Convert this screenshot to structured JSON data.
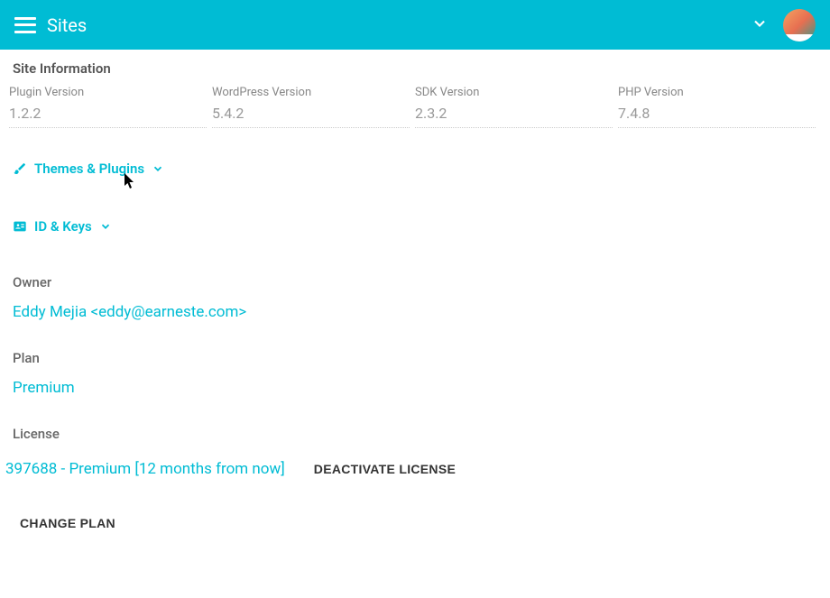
{
  "header": {
    "title": "Sites"
  },
  "siteInfo": {
    "heading": "Site Information",
    "fields": {
      "pluginVersion": {
        "label": "Plugin Version",
        "value": "1.2.2"
      },
      "wpVersion": {
        "label": "WordPress Version",
        "value": "5.4.2"
      },
      "sdkVersion": {
        "label": "SDK Version",
        "value": "2.3.2"
      },
      "phpVersion": {
        "label": "PHP Version",
        "value": "7.4.8"
      }
    }
  },
  "collapsibles": {
    "themesPlugins": "Themes & Plugins",
    "idKeys": "ID & Keys"
  },
  "owner": {
    "label": "Owner",
    "value": "Eddy Mejia <eddy@earneste.com>"
  },
  "plan": {
    "label": "Plan",
    "value": "Premium"
  },
  "license": {
    "label": "License",
    "value": "397688 - Premium [12 months from now]",
    "deactivate": "Deactivate License"
  },
  "actions": {
    "changePlan": "Change Plan"
  }
}
